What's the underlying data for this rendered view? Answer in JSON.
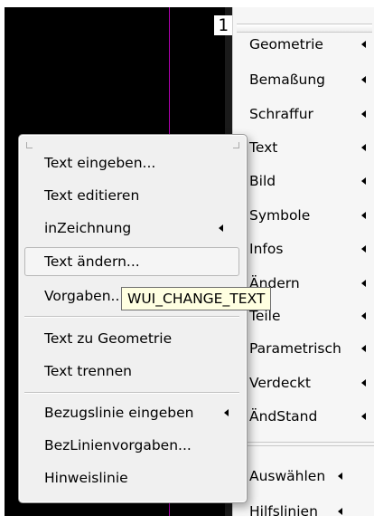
{
  "viewport": {
    "number": "1"
  },
  "side_menu": {
    "items": [
      {
        "label": "Geometrie",
        "has_submenu": true
      },
      {
        "label": "Bemaßung",
        "has_submenu": true
      },
      {
        "label": "Schraffur",
        "has_submenu": true
      },
      {
        "label": "Text",
        "has_submenu": true
      },
      {
        "label": "Bild",
        "has_submenu": true
      },
      {
        "label": "Symbole",
        "has_submenu": true
      },
      {
        "label": "Infos",
        "has_submenu": true
      },
      {
        "label": "Ändern",
        "has_submenu": true
      },
      {
        "label": "Teile",
        "has_submenu": true
      },
      {
        "label": "Parametrisch",
        "has_submenu": true
      },
      {
        "label": "Verdeckt",
        "has_submenu": true
      },
      {
        "label": "ÄndStand",
        "has_submenu": true
      },
      {
        "label": "Auswählen",
        "has_submenu": true
      },
      {
        "label": "Hilfslinien",
        "has_submenu": true
      }
    ]
  },
  "popup_menu": {
    "items": [
      {
        "label": "Text eingeben...",
        "has_submenu": false
      },
      {
        "label": "Text editieren",
        "has_submenu": false
      },
      {
        "label": "inZeichnung",
        "has_submenu": true
      },
      {
        "label": "Text ändern...",
        "has_submenu": false,
        "highlighted": true
      },
      {
        "label": "Vorgaben...",
        "has_submenu": false
      },
      {
        "label": "Text zu Geometrie",
        "has_submenu": false
      },
      {
        "label": "Text trennen",
        "has_submenu": false
      },
      {
        "label": "Bezugslinie eingeben",
        "has_submenu": true
      },
      {
        "label": "BezLinienvorgaben...",
        "has_submenu": false
      },
      {
        "label": "Hinweislinie",
        "has_submenu": false
      }
    ]
  },
  "tooltip": {
    "text": "WUI_CHANGE_TEXT"
  }
}
